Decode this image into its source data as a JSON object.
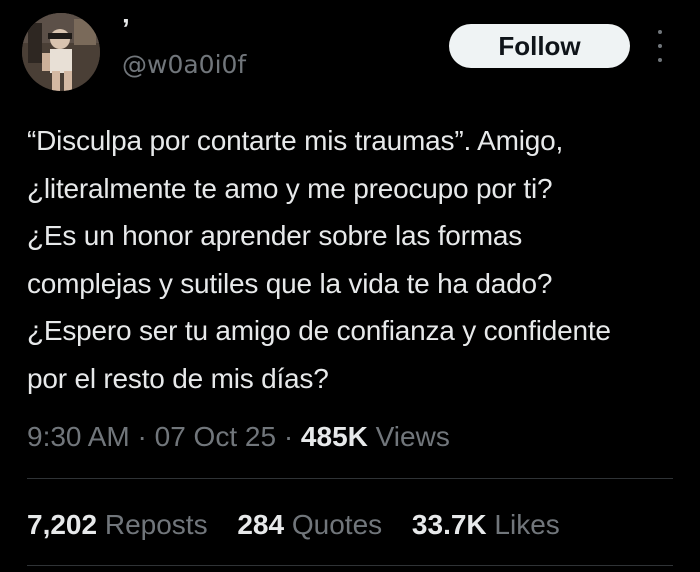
{
  "author": {
    "display_name": "’",
    "handle": "@w0a0i0f"
  },
  "follow_label": "Follow",
  "tweet_lines": [
    "“Disculpa por contarte mis traumas”. Amigo,",
    "¿literalmente te amo y me preocupo por ti?",
    "¿Es un honor aprender sobre las formas",
    "complejas y sutiles que la vida te ha dado?",
    "¿Espero ser tu amigo de confianza y confidente",
    "por el resto de mis días?"
  ],
  "meta": {
    "time": "9:30 AM",
    "sep": "·",
    "date": "07 Oct 25",
    "views_count": "485K",
    "views_label": "Views"
  },
  "stats": {
    "reposts_count": "7,202",
    "reposts_label": "Reposts",
    "quotes_count": "284",
    "quotes_label": "Quotes",
    "likes_count": "33.7K",
    "likes_label": "Likes"
  },
  "colors": {
    "background": "#000000",
    "text_primary": "#e7e9ea",
    "text_secondary": "#71767b",
    "follow_bg": "#eff3f4",
    "divider": "#2f3336"
  }
}
